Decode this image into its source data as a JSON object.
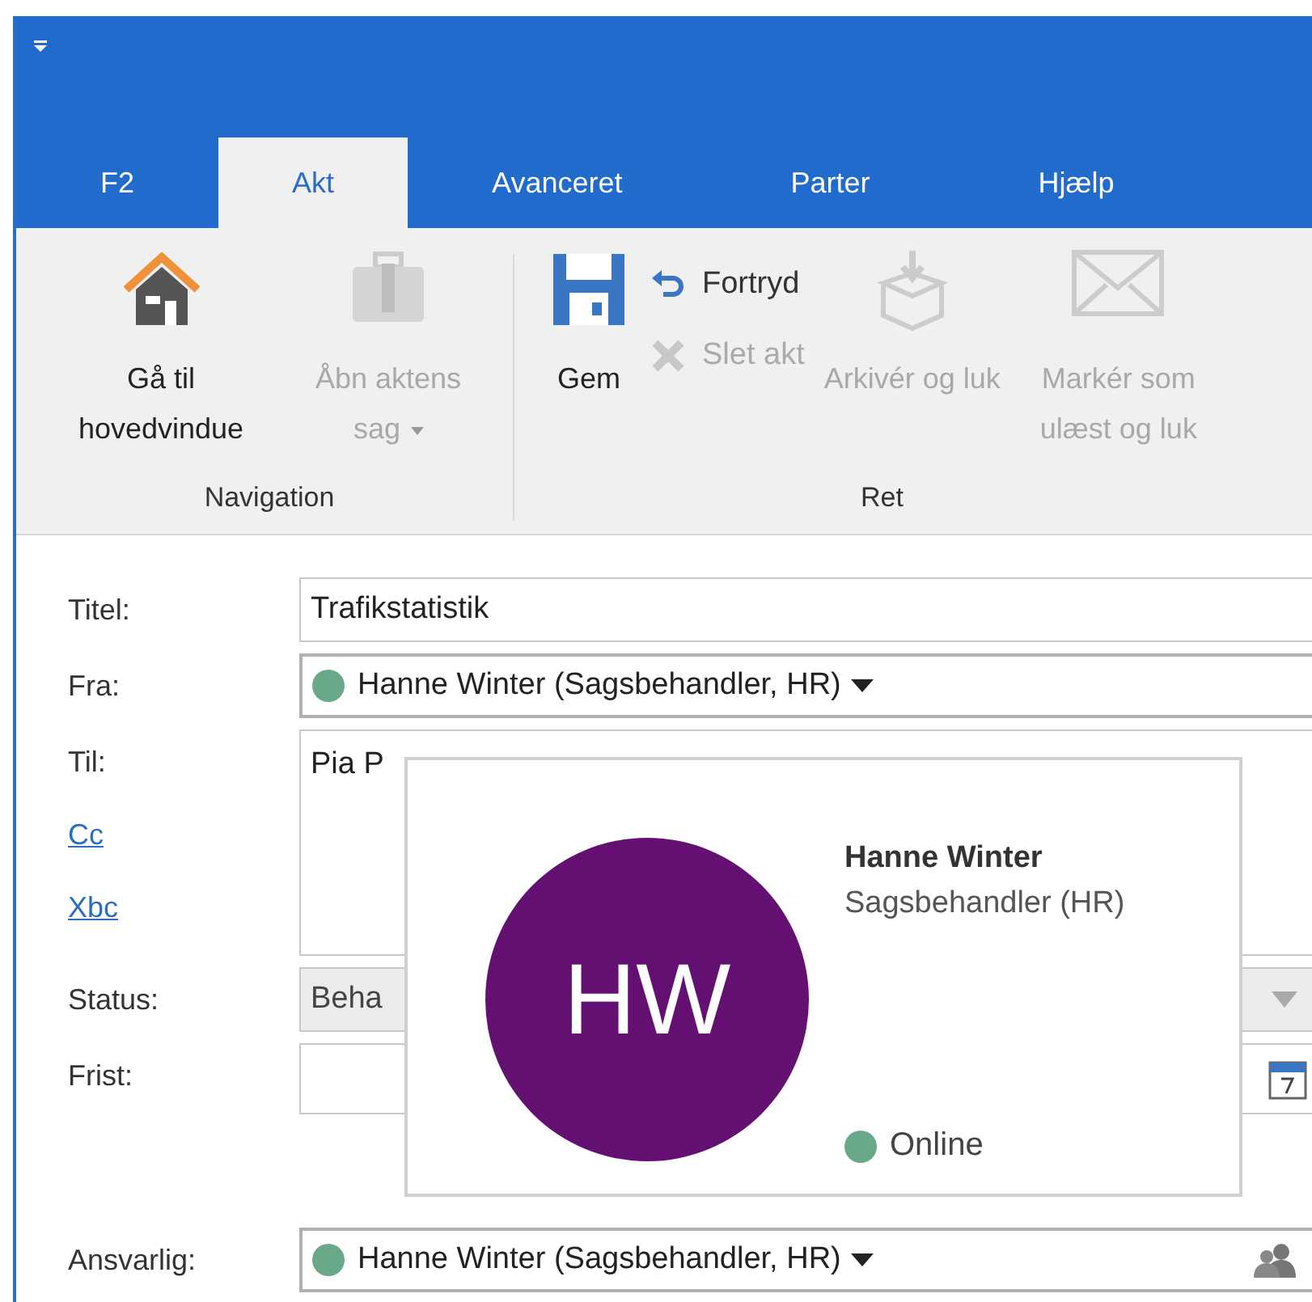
{
  "tabs": [
    {
      "label": "F2",
      "selected": false
    },
    {
      "label": "Akt",
      "selected": true
    },
    {
      "label": "Avanceret",
      "selected": false
    },
    {
      "label": "Parter",
      "selected": false
    },
    {
      "label": "Hjælp",
      "selected": false
    }
  ],
  "ribbon_groups": [
    {
      "label": "Navigation",
      "items": [
        {
          "kind": "large",
          "label": "Gå til hovedvindue",
          "disabled": false,
          "dropdown": false
        },
        {
          "kind": "large",
          "label": "Åbn aktens sag",
          "disabled": true,
          "dropdown": true
        }
      ]
    },
    {
      "label": "Ret",
      "items": [
        {
          "kind": "large",
          "label": "Gem",
          "disabled": false,
          "dropdown": false
        },
        {
          "kind": "stack",
          "items": [
            {
              "label": "Fortryd",
              "disabled": false
            },
            {
              "label": "Slet akt",
              "disabled": true
            }
          ]
        },
        {
          "kind": "large",
          "label": "Arkivér og luk",
          "disabled": true,
          "dropdown": false
        },
        {
          "kind": "large",
          "label": "Markér som ulæst og luk",
          "disabled": true,
          "dropdown": false
        }
      ]
    }
  ],
  "form": [
    {
      "kind": "text",
      "label": "Titel:",
      "value": "Trafikstatistik"
    },
    {
      "kind": "person",
      "label": "Fra:",
      "value": "Hanne Winter (Sagsbehandler, HR)",
      "color": "#6aa88a"
    },
    {
      "kind": "recipients",
      "label": "Til:",
      "links": [
        "Cc",
        "Xbc"
      ],
      "value": "Pia P"
    },
    {
      "kind": "select",
      "label": "Status:",
      "value": "Beha"
    },
    {
      "kind": "date",
      "label": "Frist:"
    },
    {
      "kind": "person",
      "label": "Ansvarlig:",
      "value": "Hanne Winter (Sagsbehandler, HR)",
      "color": "#6aa88a",
      "people_button": true
    }
  ],
  "contact_card": {
    "initials": "HW",
    "name": "Hanne Winter",
    "role": "Sagsbehandler (HR)",
    "presence": {
      "label": "Online",
      "color": "#6aa88a"
    }
  }
}
